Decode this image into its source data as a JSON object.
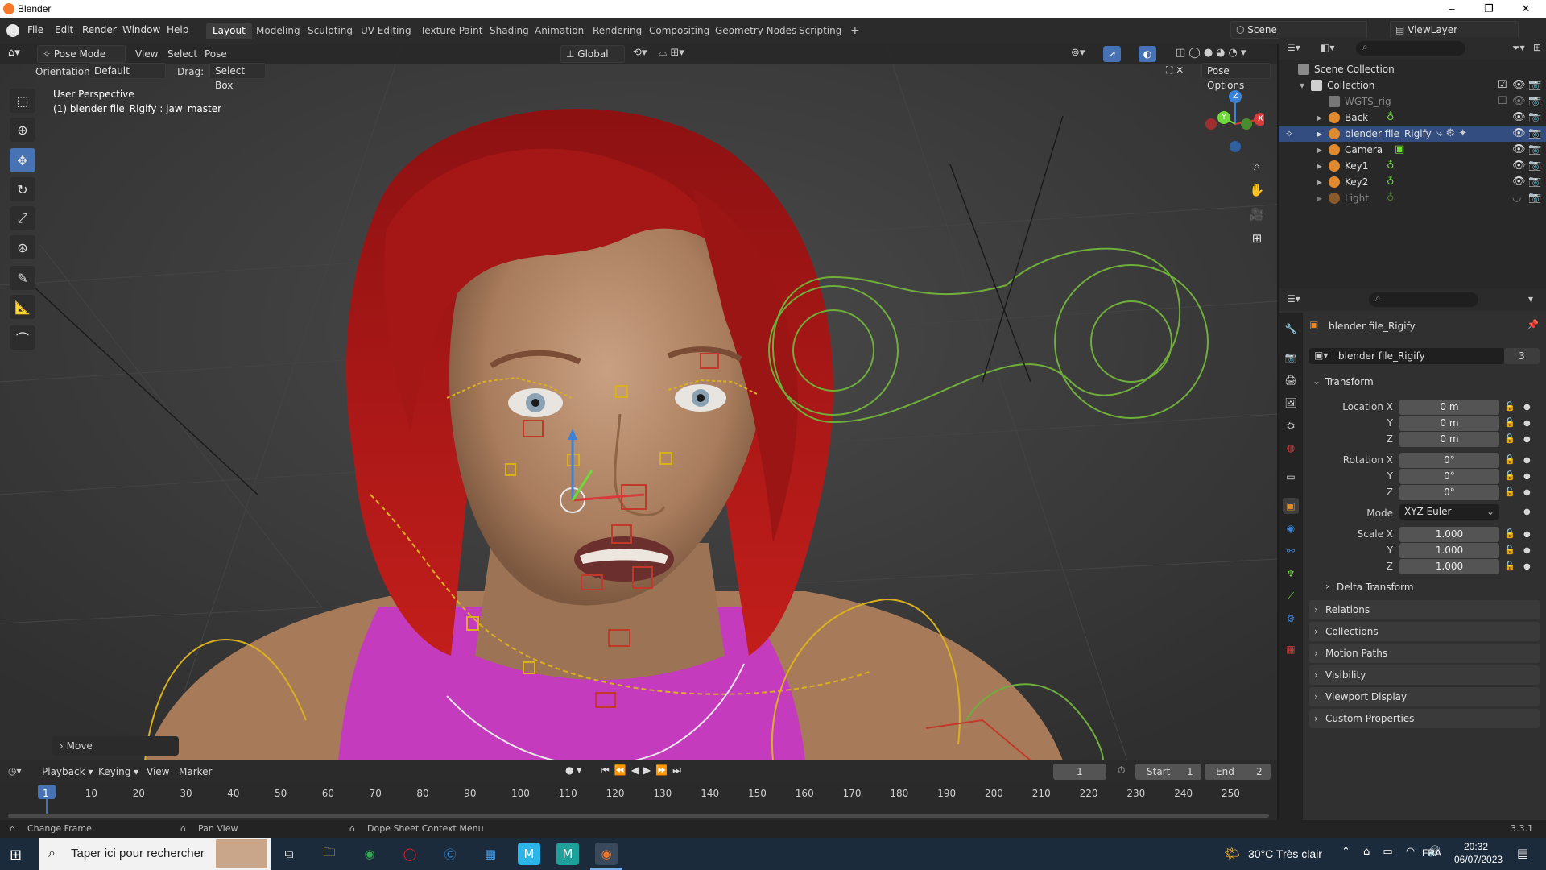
{
  "window": {
    "title": "Blender",
    "minimize": "–",
    "maximize": "❐",
    "close": "✕"
  },
  "menubar": {
    "items": [
      "File",
      "Edit",
      "Render",
      "Window",
      "Help"
    ],
    "workspaces": [
      "Layout",
      "Modeling",
      "Sculpting",
      "UV Editing",
      "Texture Paint",
      "Shading",
      "Animation",
      "Rendering",
      "Compositing",
      "Geometry Nodes",
      "Scripting"
    ],
    "add_tab": "+",
    "scene": "Scene",
    "view_layer": "ViewLayer"
  },
  "viewport_header": {
    "mode": "Pose Mode",
    "menus": [
      "View",
      "Select",
      "Pose"
    ],
    "transform_orientation": "Global",
    "orientation_label": "Orientation:",
    "orientation_value": "Default",
    "drag_label": "Drag:",
    "drag_value": "Select Box",
    "pose_options": "Pose Options"
  },
  "viewport": {
    "perspective": "User Perspective",
    "active_info": "(1) blender file_Rigify : jaw_master",
    "last_op": "Move",
    "gizmo": {
      "x": "X",
      "y": "Y",
      "z": "Z"
    }
  },
  "outliner": {
    "root": "Scene Collection",
    "items": [
      {
        "name": "Collection",
        "indent": 0
      },
      {
        "name": "WGTS_rig",
        "indent": 1
      },
      {
        "name": "Back",
        "indent": 1
      },
      {
        "name": "blender file_Rigify",
        "indent": 1
      },
      {
        "name": "Camera",
        "indent": 1
      },
      {
        "name": "Key1",
        "indent": 1
      },
      {
        "name": "Key2",
        "indent": 1
      },
      {
        "name": "Light",
        "indent": 1
      }
    ]
  },
  "properties": {
    "object_name": "blender file_Rigify",
    "data_name": "blender file_Rigify",
    "users": "3",
    "transform_header": "Transform",
    "location": {
      "label_x": "Location X",
      "x": "0 m",
      "y": "0 m",
      "z": "0 m"
    },
    "rotation": {
      "label_x": "Rotation X",
      "x": "0°",
      "y": "0°",
      "z": "0°"
    },
    "mode_label": "Mode",
    "mode_value": "XYZ Euler",
    "scale": {
      "label_x": "Scale X",
      "x": "1.000",
      "y": "1.000",
      "z": "1.000"
    },
    "axis_y": "Y",
    "axis_z": "Z",
    "delta_transform": "Delta Transform",
    "panels": [
      "Relations",
      "Collections",
      "Motion Paths",
      "Visibility",
      "Viewport Display",
      "Custom Properties"
    ]
  },
  "timeline": {
    "menus": [
      "Playback",
      "Keying",
      "View",
      "Marker"
    ],
    "current_frame": "1",
    "start_label": "Start",
    "start": "1",
    "end_label": "End",
    "end": "2",
    "ruler": [
      "1",
      "10",
      "20",
      "30",
      "40",
      "50",
      "60",
      "70",
      "80",
      "90",
      "100",
      "110",
      "120",
      "130",
      "140",
      "150",
      "160",
      "170",
      "180",
      "190",
      "200",
      "210",
      "220",
      "230",
      "240",
      "250"
    ]
  },
  "statusbar": {
    "hint1": "Change Frame",
    "hint2": "Pan View",
    "hint3": "Dope Sheet Context Menu",
    "version": "3.3.1"
  },
  "taskbar": {
    "search_placeholder": "Taper ici pour rechercher",
    "weather": "30°C  Très clair",
    "language": "FRA",
    "time": "20:32",
    "date": "06/07/2023"
  },
  "colors": {
    "accent": "#4772b3",
    "selection": "#334d80",
    "bone_yellow": "#d9b11e",
    "bone_red": "#c0392b",
    "bone_green": "#6fae3a",
    "hair": "#b3191a",
    "top": "#c53bbd"
  }
}
